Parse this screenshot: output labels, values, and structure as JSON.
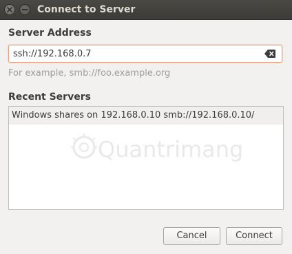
{
  "window": {
    "title": "Connect to Server",
    "close_icon": "close-icon",
    "minimize_icon": "minimize-icon"
  },
  "server_address": {
    "label": "Server Address",
    "value": "ssh://192.168.0.7",
    "hint": "For example, smb://foo.example.org",
    "clear_icon": "backspace-clear-icon",
    "accent_color": "#e8a07c"
  },
  "recent_servers": {
    "label": "Recent Servers",
    "items": [
      {
        "label": "Windows shares on 192.168.0.10  smb://192.168.0.10/"
      }
    ]
  },
  "watermark": {
    "text": "Quantrimang",
    "icon": "lightbulb-icon"
  },
  "buttons": {
    "cancel": "Cancel",
    "connect": "Connect"
  }
}
